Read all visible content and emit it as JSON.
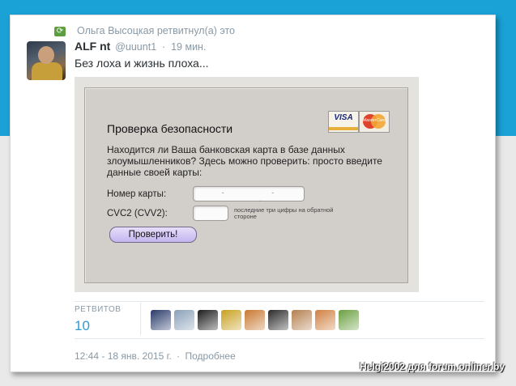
{
  "retweet_notice": {
    "text": "Ольга Высоцкая ретвитнул(а) это",
    "icon": "retweet-icon"
  },
  "tweet": {
    "author_name": "ALF nt",
    "author_handle": "@uuunt1",
    "separator": "·",
    "time_ago": "19 мин.",
    "text": "Без лоха и жизнь плоха..."
  },
  "media": {
    "title": "Проверка безопасности",
    "description": "Находится ли Ваша банковская карта в базе данных злоумышленников? Здесь можно проверить: просто введите данные своей карты:",
    "card_number_label": "Номер карты:",
    "cvc_label": "CVC2 (CVV2):",
    "hint": "последние три цифры на обратной стороне",
    "check_button": "Проверить!",
    "visa_label": "VISA",
    "mastercard_label": "MasterCard"
  },
  "stats": {
    "retweets_label": "РЕТВИТОВ",
    "retweets_count": "10",
    "retweeter_colors": [
      "#2a3a6a",
      "#8aa0b8",
      "#1c1c1c",
      "#c8a020",
      "#c87830",
      "#2a2a2a",
      "#b48050",
      "#d08040",
      "#6aa040"
    ]
  },
  "footer": {
    "timestamp": "12:44 - 18 янв. 2015 г.",
    "separator": "·",
    "details_link": "Подробнее"
  },
  "watermark": "Helgi2002 для forum.onliner.by",
  "colors": {
    "header_blue": "#1aa1d6",
    "link_blue": "#2f9bd6",
    "muted": "#8899a6",
    "retweet_green": "#5c9e40"
  }
}
